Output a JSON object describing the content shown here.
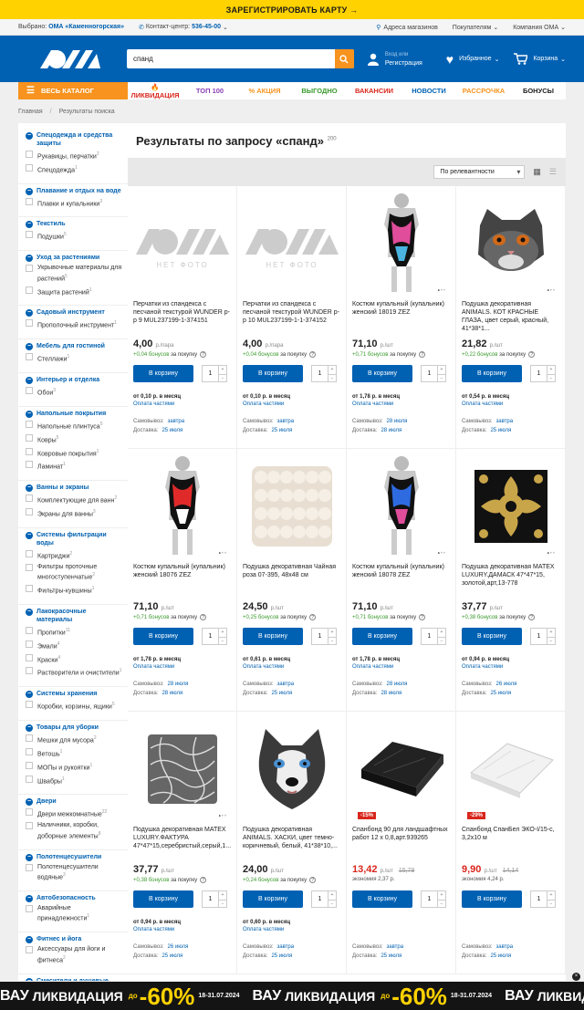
{
  "topbar": {
    "text": "ЗАРЕГИСТРИРОВАТЬ КАРТУ →"
  },
  "infobar": {
    "selected_label": "Выбрано:",
    "selected_store": "ОМА «Каменногорская»",
    "contact_label": "Контакт-центр:",
    "contact_phone": "536-45-00",
    "store_addresses": "Адреса магазинов",
    "buyers": "Покупателям",
    "company": "Компания ОМА"
  },
  "header": {
    "search_value": "спанд",
    "login_small": "Вход или",
    "login": "Регистрация",
    "favorites": "Избранное",
    "cart": "Корзина"
  },
  "nav": {
    "catalog": "ВЕСЬ КАТАЛОГ",
    "items": [
      {
        "label": "ЛИКВИДАЦИЯ",
        "color": "#d9261c"
      },
      {
        "label": "ТОП 100",
        "color": "#8a3fb5"
      },
      {
        "label": "АКЦИЯ",
        "color": "#f7931e"
      },
      {
        "label": "ВЫГОДНО",
        "color": "#3a9a2d"
      },
      {
        "label": "ВАКАНСИИ",
        "color": "#d9261c"
      },
      {
        "label": "НОВОСТИ",
        "color": "#0061b3"
      },
      {
        "label": "РАССРОЧКА",
        "color": "#f7931e"
      },
      {
        "label": "БОНУСЫ",
        "color": "#222222"
      }
    ]
  },
  "breadcrumbs": {
    "home": "Главная",
    "current": "Результаты поиска"
  },
  "results": {
    "title": "Результаты по запросу «спанд»",
    "count": "200",
    "sort": "По релевантности"
  },
  "sidebar": [
    {
      "h": "Спецодежда и средства защиты",
      "o": [
        [
          "Рукавицы, перчатки",
          "2"
        ],
        [
          "Спецодежда",
          "1"
        ]
      ]
    },
    {
      "h": "Плавание и отдых на воде",
      "o": [
        [
          "Плавки и купальники",
          "3"
        ]
      ]
    },
    {
      "h": "Текстиль",
      "o": [
        [
          "Подушки",
          "5"
        ]
      ]
    },
    {
      "h": "Уход за растениями",
      "o": [
        [
          "Укрывочные материалы для растений",
          "5"
        ],
        [
          "Защита растений",
          "1"
        ]
      ]
    },
    {
      "h": "Садовый инструмент",
      "o": [
        [
          "Прополочный инструмент",
          "1"
        ]
      ]
    },
    {
      "h": "Мебель для гостиной",
      "o": [
        [
          "Стеллажи",
          "1"
        ]
      ]
    },
    {
      "h": "Интерьер и отделка",
      "o": [
        [
          "Обои",
          "3"
        ]
      ]
    },
    {
      "h": "Напольные покрытия",
      "o": [
        [
          "Напольные плинтуса",
          "5"
        ],
        [
          "Ковры",
          "5"
        ],
        [
          "Ковровые покрытия",
          "1"
        ],
        [
          "Ламинат",
          "1"
        ]
      ]
    },
    {
      "h": "Ванны и экраны",
      "o": [
        [
          "Комплектующие для ванн",
          "2"
        ],
        [
          "Экраны для ванны",
          "3"
        ]
      ]
    },
    {
      "h": "Системы фильтрации воды",
      "o": [
        [
          "Картриджи",
          "2"
        ],
        [
          "Фильтры проточные многоступенчатые",
          "2"
        ],
        [
          "Фильтры-кувшины",
          "1"
        ]
      ]
    },
    {
      "h": "Лакокрасочные материалы",
      "o": [
        [
          "Пропитки",
          "11"
        ],
        [
          "Эмали",
          "4"
        ],
        [
          "Краски",
          "4"
        ],
        [
          "Растворители и очистители",
          "1"
        ]
      ]
    },
    {
      "h": "Системы хранения",
      "o": [
        [
          "Коробки, корзины, ящики",
          "5"
        ]
      ]
    },
    {
      "h": "Товары для уборки",
      "o": [
        [
          "Мешки для мусора",
          "2"
        ],
        [
          "Ветошь",
          "1"
        ],
        [
          "МОПы и рукоятки",
          "1"
        ],
        [
          "Швабры",
          "1"
        ]
      ]
    },
    {
      "h": "Двери",
      "o": [
        [
          "Двери межкомнатные",
          "22"
        ],
        [
          "Наличники, коробки, доборные элементы",
          "8"
        ]
      ]
    },
    {
      "h": "Полотенцесушители",
      "o": [
        [
          "Полотенцесушители водяные",
          "3"
        ]
      ]
    },
    {
      "h": "Автобезопасность",
      "o": [
        [
          "Аварийные принадлежности",
          "1"
        ]
      ]
    },
    {
      "h": "Фитнес и йога",
      "o": [
        [
          "Аксессуары для йоги и фитнеса",
          "2"
        ]
      ]
    },
    {
      "h": "Смесители и душевые",
      "o": []
    }
  ],
  "labels": {
    "buy": "В корзину",
    "qty": "1",
    "installment_link": "Оплата частями",
    "pickup": "Самовывоз:",
    "delivery": "Доставка:",
    "bonus_suffix": "за покупку",
    "economy": "экономия",
    "no_photo": "НЕТ ФОТО"
  },
  "products": [
    {
      "name": "Перчатки из спандекса с песчаной текстурой WUNDER р-р 9 MUL237199-1-374151",
      "price": "4,00",
      "unit": "р./пара",
      "bonus": "+0,04 бонусов",
      "inst": "от 0,10 р. в месяц",
      "pickup": "завтра",
      "delivery": "25 июля",
      "img": "nophoto"
    },
    {
      "name": "Перчатки из спандекса с песчаной текстурой WUNDER р-р 10 MUL237199-1-1-374152",
      "price": "4,00",
      "unit": "р./пара",
      "bonus": "+0,04 бонусов",
      "inst": "от 0,10 р. в месяц",
      "pickup": "завтра",
      "delivery": "25 июля",
      "img": "nophoto"
    },
    {
      "name": "Костюм купальный (купальник) женский 18019 ZEZ",
      "price": "71,10",
      "unit": "р./шт",
      "bonus": "+0,71 бонусов",
      "inst": "от 1,78 р. в месяц",
      "pickup": "28 июля",
      "delivery": "28 июля",
      "img": "swim1"
    },
    {
      "name": "Подушка декоративная ANIMALS. КОТ КРАСНЫЕ ГЛАЗА, цвет серый, красный, 41*38*1...",
      "price": "21,82",
      "unit": "р./шт",
      "bonus": "+0,22 бонусов",
      "inst": "от 0,54 р. в месяц",
      "pickup": "завтра",
      "delivery": "25 июля",
      "img": "cat"
    },
    {
      "name": "Костюм купальный (купальник) женский 18076 ZEZ",
      "price": "71,10",
      "unit": "р./шт",
      "bonus": "+0,71 бонусов",
      "inst": "от 1,78 р. в месяц",
      "pickup": "28 июля",
      "delivery": "28 июля",
      "img": "swim2"
    },
    {
      "name": "Подушка декоративная Чайная роза 07-395, 48х48 см",
      "price": "24,50",
      "unit": "р./шт",
      "bonus": "+0,25 бонусов",
      "inst": "от 0,61 р. в месяц",
      "pickup": "завтра",
      "delivery": "25 июля",
      "img": "fluffy"
    },
    {
      "name": "Костюм купальный (купальник) женский 18078 ZEZ",
      "price": "71,10",
      "unit": "р./шт",
      "bonus": "+0,71 бонусов",
      "inst": "от 1,78 р. в месяц",
      "pickup": "28 июля",
      "delivery": "28 июля",
      "img": "swim3"
    },
    {
      "name": "Подушка декоративная MATEX LUXURY.ДАМАСК 47*47*15, золотой,арт,13-778",
      "price": "37,77",
      "unit": "р./шт",
      "bonus": "+0,38 бонусов",
      "inst": "от 0,94 р. в месяц",
      "pickup": "26 июля",
      "delivery": "25 июля",
      "img": "damask"
    },
    {
      "name": "Подушка декоративная MATEX LUXURY.ФАКТУРА 47*47*15,серебристый,серый,1...",
      "price": "37,77",
      "unit": "р./шт",
      "bonus": "+0,38 бонусов",
      "inst": "от 0,94 р. в месяц",
      "pickup": "26 июля",
      "delivery": "25 июля",
      "img": "silver"
    },
    {
      "name": "Подушка декоративная ANIMALS. ХАСКИ, цвет темно-коричневый, белый, 41*38*10,...",
      "price": "24,00",
      "unit": "р./шт",
      "bonus": "+0,24 бонусов",
      "inst": "от 0,60 р. в месяц",
      "pickup": "завтра",
      "delivery": "25 июля",
      "img": "husky"
    },
    {
      "name": "Спанбонд 90 для ландшафтных работ 12 х 0,8,арт.939265",
      "price": "13,42",
      "unit": "р./шт",
      "old": "15,79",
      "econ": "2,37 р.",
      "badge": "-15%",
      "pickup": "завтра",
      "delivery": "25 июля",
      "img": "black"
    },
    {
      "name": "Спанбонд СпанБел ЭКО-I/15-с, 3,2х10 м",
      "price": "9,90",
      "unit": "р./шт",
      "old": "14,14",
      "econ": "4,24 р.",
      "badge": "-29%",
      "pickup": "завтра",
      "delivery": "25 июля",
      "img": "white"
    }
  ],
  "banner": {
    "wow": "ВАУ",
    "liq": "ЛИКВИДАЦИЯ",
    "upto": "до",
    "pct": "-60%",
    "dates": "18-31.07.2024"
  }
}
